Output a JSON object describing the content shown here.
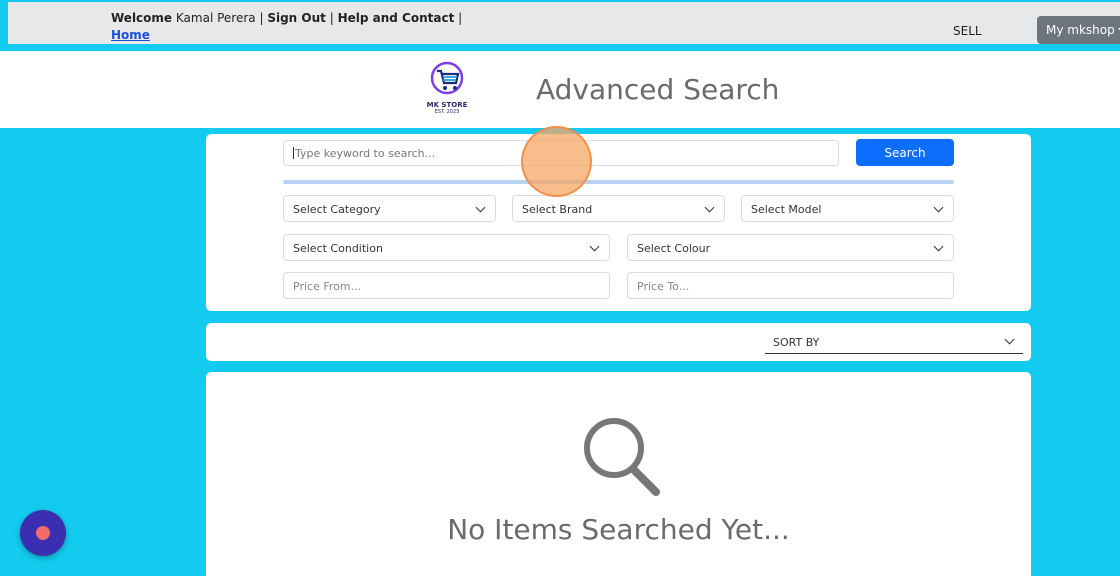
{
  "topbar": {
    "welcome_label": "Welcome",
    "user_name": "Kamal Perera",
    "sep1": "|",
    "sign_out": "Sign Out",
    "sep2": "|",
    "help": "Help and Contact",
    "sep3": "|",
    "home": "Home",
    "sell": "SELL",
    "my_shop": "My mkshop"
  },
  "header": {
    "logo_text": "MK STORE",
    "logo_sub": "EST. 2023",
    "title": "Advanced Search"
  },
  "search": {
    "keyword_placeholder": "Type keyword to search...",
    "search_button": "Search",
    "category": "Select Category",
    "brand": "Select Brand",
    "model": "Select Model",
    "condition": "Select Condition",
    "colour": "Select Colour",
    "price_from": "Price From...",
    "price_to": "Price To..."
  },
  "sort": {
    "label": "SORT BY"
  },
  "results": {
    "empty_message": "No Items Searched Yet..."
  },
  "colors": {
    "page_bg": "#12cbee",
    "primary": "#0d6efd",
    "myshop_bg": "#6c757d"
  }
}
